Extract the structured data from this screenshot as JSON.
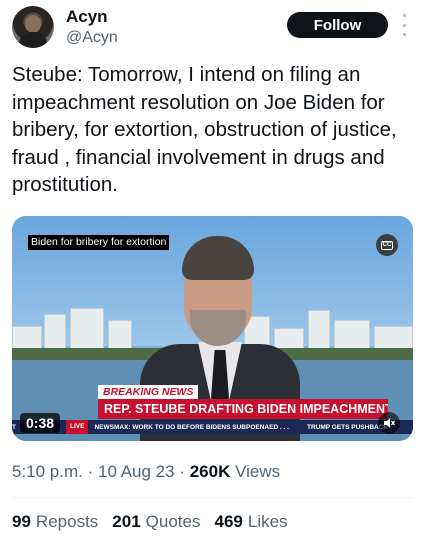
{
  "author": {
    "name": "Acyn",
    "handle": "@Acyn"
  },
  "follow_label": "Follow",
  "tweet_text": "Steube: Tomorrow, I intend on filing an impeachment resolution on Joe Biden for bribery, for extortion, obstruction of justice, fraud , financial involvement in drugs and prostitution.",
  "video": {
    "caption": "Biden for bribery for extortion",
    "cc_label": "CC",
    "breaking_label": "BREAKING NEWS",
    "headline": "REP. STEUBE DRAFTING BIDEN IMPEACHMENT ARTICLES",
    "ticker_live": "LIVE",
    "ticker_prefix": "T",
    "ticker_text_1": "NEWSMAX: WORK TO DO BEFORE BIDENS SUBPOENAED . . .",
    "ticker_text_2": "TRUMP GETS PUSHBACK",
    "timer": "0:38"
  },
  "meta": {
    "time": "5:10 p.m.",
    "date": "10 Aug 23",
    "views_count": "260K",
    "views_label": "Views"
  },
  "stats": {
    "reposts_count": "99",
    "reposts_label": "Reposts",
    "quotes_count": "201",
    "quotes_label": "Quotes",
    "likes_count": "469",
    "likes_label": "Likes"
  }
}
